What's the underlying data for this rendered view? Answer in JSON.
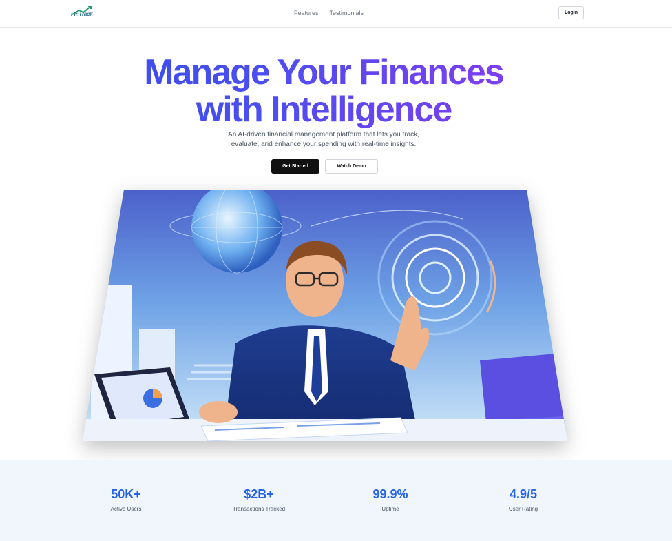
{
  "brand": {
    "logo_text": "FinTrack"
  },
  "nav": {
    "links": [
      "Features",
      "Testimonials"
    ],
    "login_label": "Login"
  },
  "hero": {
    "title_line1": "Manage Your Finances",
    "title_line2": "with Intelligence",
    "subtitle_line1": "An AI-driven financial management platform that lets you track,",
    "subtitle_line2": "evaluate, and enhance your spending with real-time insights.",
    "primary_cta": "Get Started",
    "secondary_cta": "Watch Demo",
    "image_subject": "man-with-globe-and-dashboards-illustration"
  },
  "stats": [
    {
      "value": "50K+",
      "label": "Active Users"
    },
    {
      "value": "$2B+",
      "label": "Transactions Tracked"
    },
    {
      "value": "99.9%",
      "label": "Uptime"
    },
    {
      "value": "4.9/5",
      "label": "User Rating"
    }
  ],
  "colors": {
    "accent": "#2563eb",
    "gradient_start": "#2f4ee6",
    "gradient_end": "#8f3ef2",
    "stats_bg": "#f1f6fd",
    "primary_button": "#111111"
  }
}
